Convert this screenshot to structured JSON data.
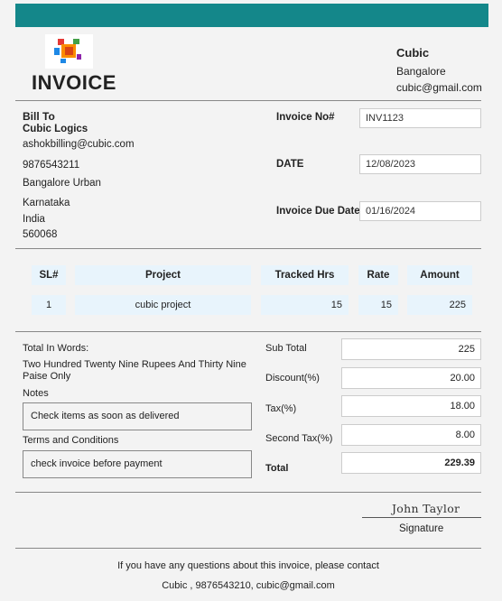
{
  "header": {
    "title": "INVOICE",
    "logo": "colored-squares-logo"
  },
  "company": {
    "name": "Cubic",
    "city": "Bangalore",
    "email": "cubic@gmail.com"
  },
  "bill_to": {
    "label": "Bill To",
    "name": "Cubic Logics",
    "email": "ashokbilling@cubic.com",
    "phone": "9876543211",
    "area": "Bangalore Urban",
    "state": "Karnataka",
    "country": "India",
    "pincode": "560068"
  },
  "invoice_fields": {
    "number_label": "Invoice No#",
    "number": "INV1123",
    "date_label": "DATE",
    "date": "12/08/2023",
    "due_label": "Invoice Due Date",
    "due": "01/16/2024"
  },
  "table": {
    "headers": [
      "SL#",
      "Project",
      "Tracked Hrs",
      "Rate",
      "Amount"
    ],
    "rows": [
      {
        "sl": "1",
        "project": "cubic project",
        "hrs": "15",
        "rate": "15",
        "amount": "225"
      }
    ]
  },
  "words": {
    "label": "Total In Words:",
    "value": "Two Hundred Twenty Nine Rupees And Thirty Nine Paise Only"
  },
  "notes": {
    "label": "Notes",
    "value": "Check items as soon as delivered"
  },
  "terms": {
    "label": "Terms and Conditions",
    "value": "check invoice before payment"
  },
  "totals": {
    "subtotal_label": "Sub Total",
    "subtotal": "225",
    "discount_label": "Discount(%)",
    "discount": "20.00",
    "tax_label": "Tax(%)",
    "tax": "18.00",
    "second_tax_label": "Second Tax(%)",
    "second_tax": "8.00",
    "total_label": "Total",
    "total": "229.39"
  },
  "signature": {
    "name": "John Taylor",
    "label": "Signature"
  },
  "footer": {
    "line1": "If you have any questions about this invoice, please contact",
    "line2": "Cubic , 9876543210, cubic@gmail.com"
  },
  "colors": {
    "topbar": "#14878a",
    "table_cell": "#e8f4fc"
  }
}
